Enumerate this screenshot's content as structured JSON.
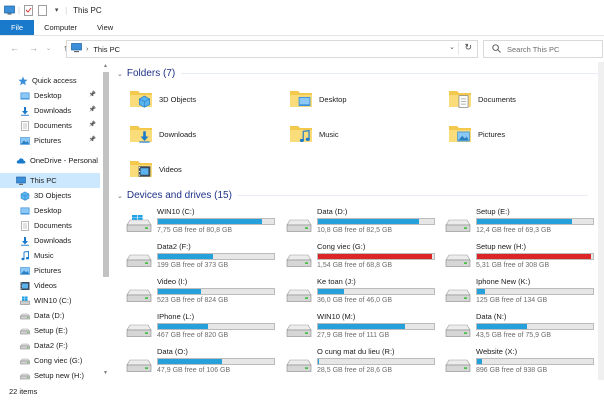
{
  "window": {
    "title": "This PC"
  },
  "ribbon": {
    "tabs": [
      "File",
      "Computer",
      "View"
    ]
  },
  "address": {
    "location": "This PC",
    "search_placeholder": "Search This PC"
  },
  "sidebar": {
    "items": [
      {
        "label": "Quick access",
        "icon": "star-icon",
        "pinned": false
      },
      {
        "label": "Desktop",
        "icon": "desktop-folder-icon",
        "pinned": true
      },
      {
        "label": "Downloads",
        "icon": "downloads-folder-icon",
        "pinned": true
      },
      {
        "label": "Documents",
        "icon": "documents-folder-icon",
        "pinned": true
      },
      {
        "label": "Pictures",
        "icon": "pictures-folder-icon",
        "pinned": true
      },
      {
        "label": "OneDrive - Personal",
        "icon": "cloud-icon",
        "pinned": false
      },
      {
        "label": "This PC",
        "icon": "computer-icon",
        "pinned": false,
        "selected": true
      },
      {
        "label": "3D Objects",
        "icon": "3d-objects-icon",
        "pinned": false
      },
      {
        "label": "Desktop",
        "icon": "desktop-folder-icon",
        "pinned": false
      },
      {
        "label": "Documents",
        "icon": "documents-folder-icon",
        "pinned": false
      },
      {
        "label": "Downloads",
        "icon": "downloads-folder-icon",
        "pinned": false
      },
      {
        "label": "Music",
        "icon": "music-icon",
        "pinned": false
      },
      {
        "label": "Pictures",
        "icon": "pictures-folder-icon",
        "pinned": false
      },
      {
        "label": "Videos",
        "icon": "videos-icon",
        "pinned": false
      },
      {
        "label": "WIN10 (C:)",
        "icon": "windows-drive-icon",
        "pinned": false
      },
      {
        "label": "Data (D:)",
        "icon": "drive-icon",
        "pinned": false
      },
      {
        "label": "Setup (E:)",
        "icon": "drive-icon",
        "pinned": false
      },
      {
        "label": "Data2 (F:)",
        "icon": "drive-icon",
        "pinned": false
      },
      {
        "label": "Cong viec (G:)",
        "icon": "drive-icon",
        "pinned": false
      },
      {
        "label": "Setup new (H:)",
        "icon": "drive-icon",
        "pinned": false
      }
    ]
  },
  "folders": {
    "header": "Folders (7)",
    "items": [
      {
        "label": "3D Objects",
        "icon": "3d-objects-icon"
      },
      {
        "label": "Desktop",
        "icon": "desktop-folder-icon"
      },
      {
        "label": "Documents",
        "icon": "documents-folder-icon"
      },
      {
        "label": "Downloads",
        "icon": "downloads-folder-icon"
      },
      {
        "label": "Music",
        "icon": "music-icon"
      },
      {
        "label": "Pictures",
        "icon": "pictures-folder-icon"
      },
      {
        "label": "Videos",
        "icon": "videos-icon"
      }
    ]
  },
  "drives": {
    "header": "Devices and drives (15)",
    "items": [
      {
        "name": "WIN10 (C:)",
        "free": "7,75 GB free of 80,8 GB",
        "used_fraction": 0.9,
        "critical": false,
        "windows": true
      },
      {
        "name": "Data (D:)",
        "free": "10,8 GB free of 82,5 GB",
        "used_fraction": 0.87,
        "critical": false
      },
      {
        "name": "Setup (E:)",
        "free": "12,4 GB free of 69,3 GB",
        "used_fraction": 0.82,
        "critical": false
      },
      {
        "name": "Data2 (F:)",
        "free": "199 GB free of 373 GB",
        "used_fraction": 0.47,
        "critical": false
      },
      {
        "name": "Cong viec (G:)",
        "free": "1,54 GB free of 68,8 GB",
        "used_fraction": 0.98,
        "critical": true
      },
      {
        "name": "Setup new (H:)",
        "free": "5,31 GB free of 308 GB",
        "used_fraction": 0.98,
        "critical": true
      },
      {
        "name": "Video (I:)",
        "free": "523 GB free of 824 GB",
        "used_fraction": 0.37,
        "critical": false
      },
      {
        "name": "Ke toan (J:)",
        "free": "36,0 GB free of 46,0 GB",
        "used_fraction": 0.22,
        "critical": false
      },
      {
        "name": "Iphone New (K:)",
        "free": "125 GB free of 134 GB",
        "used_fraction": 0.07,
        "critical": false
      },
      {
        "name": "IPhone (L:)",
        "free": "467 GB free of 820 GB",
        "used_fraction": 0.43,
        "critical": false
      },
      {
        "name": "WIN10 (M:)",
        "free": "27,9 GB free of 111 GB",
        "used_fraction": 0.75,
        "critical": false
      },
      {
        "name": "Data (N:)",
        "free": "43,5 GB free of 75,9 GB",
        "used_fraction": 0.43,
        "critical": false
      },
      {
        "name": "Data (O:)",
        "free": "47,9 GB free of 106 GB",
        "used_fraction": 0.55,
        "critical": false
      },
      {
        "name": "O cung mat du lieu (R:)",
        "free": "28,5 GB free of 28,6 GB",
        "used_fraction": 0.01,
        "critical": false
      },
      {
        "name": "Website (X:)",
        "free": "896 GB free of 938 GB",
        "used_fraction": 0.04,
        "critical": false
      }
    ]
  },
  "status": {
    "items_count": "22 items"
  },
  "colors": {
    "accent": "#1979ca",
    "bar_normal": "#26a0da",
    "bar_critical": "#da2626",
    "selected_bg": "#cce8ff",
    "header_text": "#1e3287"
  }
}
